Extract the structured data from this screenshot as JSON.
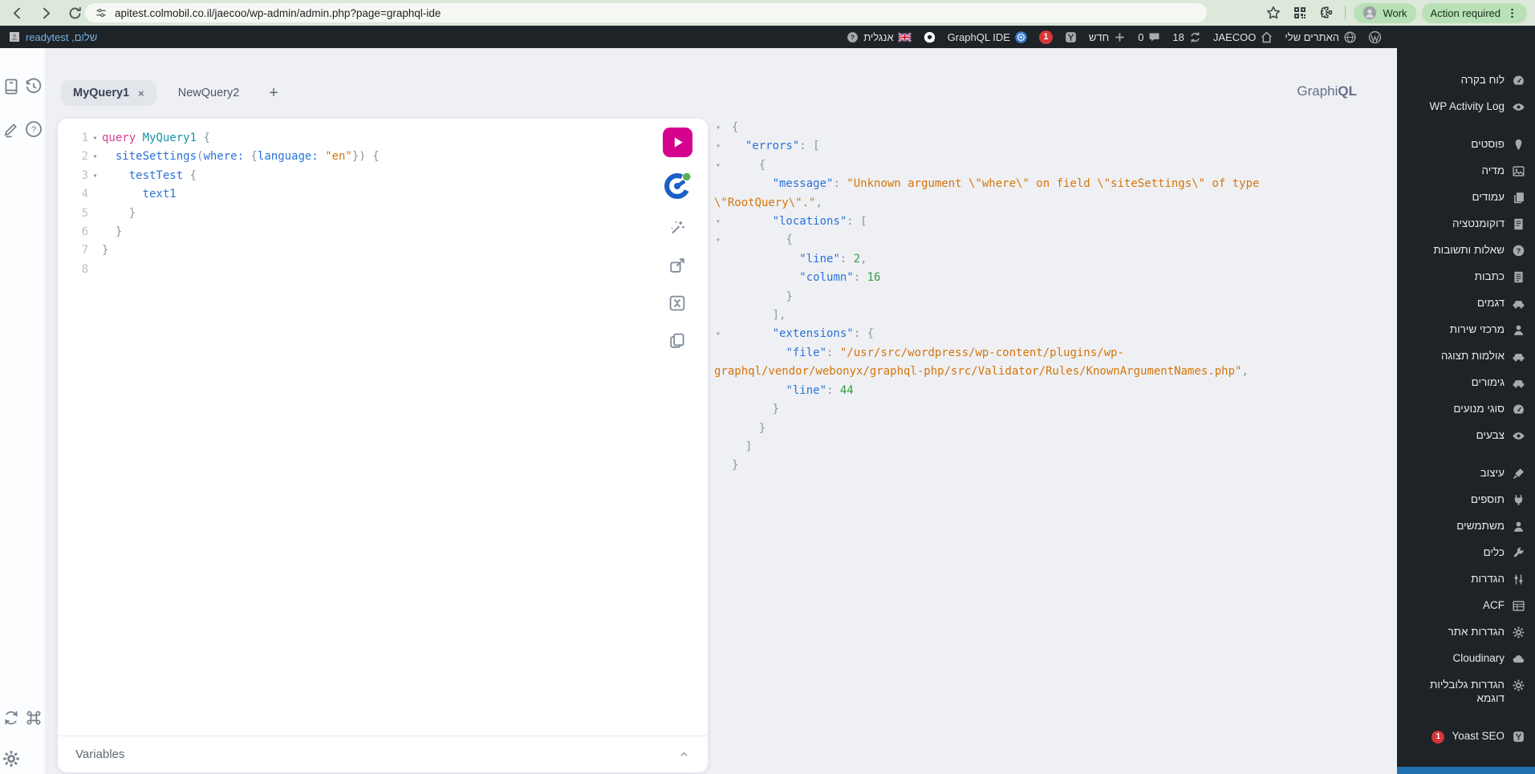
{
  "browser": {
    "url": "apitest.colmobil.co.il/jaecoo/wp-admin/admin.php?page=graphql-ide",
    "profile_label": "Work",
    "action_button": "Action required"
  },
  "admin_bar": {
    "greeting": "שלום, readytest",
    "items": [
      {
        "icon": "wp-logo",
        "name": "wordpress-logo"
      },
      {
        "icon": "network-icon",
        "label": "האתרים שלי",
        "name": "my-sites"
      },
      {
        "icon": "home-icon",
        "label": "JAECOO",
        "name": "site-name"
      },
      {
        "icon": "update-icon",
        "label": "18",
        "name": "updates"
      },
      {
        "icon": "comment-icon",
        "label": "0",
        "name": "comments"
      },
      {
        "icon": "plus-icon",
        "label": "חדש",
        "name": "new-content"
      },
      {
        "icon": "yoast-icon",
        "name": "yoast-seo"
      },
      {
        "badge": "1",
        "name": "notification"
      },
      {
        "icon": "gql-badge",
        "label": "GraphQL IDE",
        "name": "graphql-ide"
      },
      {
        "icon": "qm-icon",
        "name": "query-monitor"
      },
      {
        "icon": "flag-uk",
        "label": "אנגלית",
        "post_icon": "help-circle",
        "name": "language"
      }
    ]
  },
  "sidebar": {
    "accent": "#2271b1",
    "items": [
      {
        "label": "לוח בקרה",
        "icon": "dashboard-icon",
        "name": "dashboard"
      },
      {
        "label": "WP Activity Log",
        "icon": "eye-icon",
        "name": "wp-activity-log"
      },
      {
        "label": "פוסטים",
        "icon": "pin-icon",
        "name": "posts",
        "gap": true
      },
      {
        "label": "מדיה",
        "icon": "media-icon",
        "name": "media"
      },
      {
        "label": "עמודים",
        "icon": "pages-icon",
        "name": "pages"
      },
      {
        "label": "דוקומנטציה",
        "icon": "document-icon",
        "name": "documentation"
      },
      {
        "label": "שאלות ותשובות",
        "icon": "question-icon",
        "name": "faq"
      },
      {
        "label": "כתבות",
        "icon": "article-icon",
        "name": "articles"
      },
      {
        "label": "דגמים",
        "icon": "car-icon",
        "name": "models"
      },
      {
        "label": "מרכזי שירות",
        "icon": "person-icon",
        "name": "service-centers"
      },
      {
        "label": "אולמות תצוגה",
        "icon": "car-icon",
        "name": "showrooms"
      },
      {
        "label": "גימורים",
        "icon": "car-icon",
        "name": "trims"
      },
      {
        "label": "סוגי מנועים",
        "icon": "dashboard-icon",
        "name": "engine-types"
      },
      {
        "label": "צבעים",
        "icon": "eye-icon",
        "name": "colors"
      },
      {
        "label": "עיצוב",
        "icon": "brush-icon",
        "name": "appearance",
        "gap": true
      },
      {
        "label": "תוספים",
        "icon": "plug-icon",
        "name": "plugins"
      },
      {
        "label": "משתמשים",
        "icon": "person-icon",
        "name": "users"
      },
      {
        "label": "כלים",
        "icon": "wrench-icon",
        "name": "tools"
      },
      {
        "label": "הגדרות",
        "icon": "sliders-icon",
        "name": "settings"
      },
      {
        "label": "ACF",
        "icon": "table-icon",
        "name": "acf"
      },
      {
        "label": "הגדרות אתר",
        "icon": "gear-icon",
        "name": "site-settings"
      },
      {
        "label": "Cloudinary",
        "icon": "cloud-icon",
        "name": "cloudinary"
      },
      {
        "label": "הגדרות גלובליות דוגמא",
        "icon": "gear-icon",
        "name": "global-settings-sample"
      },
      {
        "label": "Yoast SEO",
        "icon": "yoast-icon",
        "badge": "1",
        "name": "yoast-seo",
        "gap": true
      }
    ]
  },
  "graphiql": {
    "logo_prefix": "Graphi",
    "logo_suffix": "QL",
    "variables_label": "Variables",
    "add_tab_glyph": "+",
    "fold_glyph": "▾",
    "tabs": [
      {
        "label": "MyQuery1",
        "active": true,
        "close_glyph": "×"
      },
      {
        "label": "NewQuery2",
        "active": false
      }
    ],
    "rail_top": [
      {
        "icon": "book-icon",
        "name": "docs-button"
      },
      {
        "icon": "history-icon",
        "name": "history-button"
      },
      {
        "icon": "pencil-icon",
        "name": "edit-button"
      },
      {
        "icon": "help-outline",
        "name": "help-button"
      }
    ],
    "rail_bottom": [
      {
        "icon": "refresh-icon",
        "name": "refetch-schema-button"
      },
      {
        "icon": "cmd-icon",
        "name": "keyboard-shortcuts-button"
      },
      {
        "icon": "gear-icon",
        "name": "settings-button"
      }
    ],
    "editor_buttons": [
      {
        "icon": "play-icon",
        "name": "execute-query-button",
        "cls": "btn-play"
      },
      {
        "icon": "wpgraphql-icon",
        "name": "auth-toggle-button",
        "cls": "btn-auth"
      },
      {
        "icon": "prettify-icon",
        "name": "prettify-button"
      },
      {
        "icon": "share-icon",
        "name": "share-query-button"
      },
      {
        "icon": "merge-icon",
        "name": "merge-fragments-button"
      },
      {
        "icon": "copy-icon",
        "name": "copy-query-button"
      }
    ],
    "editor_lines": [
      {
        "num": "1",
        "fold": true,
        "tokens": [
          [
            "kw",
            "query"
          ],
          [
            "pl",
            " "
          ],
          [
            "def",
            "MyQuery1"
          ],
          [
            "pun",
            " {"
          ]
        ]
      },
      {
        "num": "2",
        "fold": true,
        "tokens": [
          [
            "pl",
            "  "
          ],
          [
            "fld",
            "siteSettings"
          ],
          [
            "pun",
            "("
          ],
          [
            "fld",
            "where:"
          ],
          [
            "pl",
            " "
          ],
          [
            "pun",
            "{"
          ],
          [
            "fld",
            "language:"
          ],
          [
            "pl",
            " "
          ],
          [
            "str",
            "\"en\""
          ],
          [
            "pun",
            "}) {"
          ]
        ]
      },
      {
        "num": "3",
        "fold": true,
        "tokens": [
          [
            "pl",
            "    "
          ],
          [
            "fld",
            "testTest"
          ],
          [
            "pun",
            " {"
          ]
        ]
      },
      {
        "num": "4",
        "fold": false,
        "tokens": [
          [
            "pl",
            "      "
          ],
          [
            "fld",
            "text1"
          ]
        ]
      },
      {
        "num": "5",
        "fold": false,
        "tokens": [
          [
            "pun",
            "    }"
          ]
        ]
      },
      {
        "num": "6",
        "fold": false,
        "tokens": [
          [
            "pun",
            "  }"
          ]
        ]
      },
      {
        "num": "7",
        "fold": false,
        "tokens": [
          [
            "pun",
            "}"
          ]
        ]
      },
      {
        "num": "8",
        "fold": false,
        "tokens": []
      }
    ],
    "response_lines": [
      {
        "fold": true,
        "tokens": [
          [
            "pun",
            "{"
          ]
        ]
      },
      {
        "fold": true,
        "tokens": [
          [
            "pl",
            "  "
          ],
          [
            "key",
            "\"errors\""
          ],
          [
            "pun",
            ": ["
          ]
        ]
      },
      {
        "fold": true,
        "tokens": [
          [
            "pl",
            "    "
          ],
          [
            "pun",
            "{"
          ]
        ]
      },
      {
        "fold": false,
        "tokens": [
          [
            "pl",
            "      "
          ],
          [
            "key",
            "\"message\""
          ],
          [
            "pun",
            ": "
          ],
          [
            "str",
            "\"Unknown argument \\\"where\\\" on field \\\"siteSettings\\\" of type \\\"RootQuery\\\".\""
          ],
          [
            "pun",
            ","
          ]
        ]
      },
      {
        "fold": true,
        "tokens": [
          [
            "pl",
            "      "
          ],
          [
            "key",
            "\"locations\""
          ],
          [
            "pun",
            ": ["
          ]
        ]
      },
      {
        "fold": true,
        "tokens": [
          [
            "pl",
            "        "
          ],
          [
            "pun",
            "{"
          ]
        ]
      },
      {
        "fold": false,
        "tokens": [
          [
            "pl",
            "          "
          ],
          [
            "key",
            "\"line\""
          ],
          [
            "pun",
            ": "
          ],
          [
            "num",
            "2"
          ],
          [
            "pun",
            ","
          ]
        ]
      },
      {
        "fold": false,
        "tokens": [
          [
            "pl",
            "          "
          ],
          [
            "key",
            "\"column\""
          ],
          [
            "pun",
            ": "
          ],
          [
            "num",
            "16"
          ]
        ]
      },
      {
        "fold": false,
        "tokens": [
          [
            "pl",
            "        "
          ],
          [
            "pun",
            "}"
          ]
        ]
      },
      {
        "fold": false,
        "tokens": [
          [
            "pl",
            "      "
          ],
          [
            "pun",
            "],"
          ]
        ]
      },
      {
        "fold": true,
        "tokens": [
          [
            "pl",
            "      "
          ],
          [
            "key",
            "\"extensions\""
          ],
          [
            "pun",
            ": {"
          ]
        ]
      },
      {
        "fold": false,
        "tokens": [
          [
            "pl",
            "        "
          ],
          [
            "key",
            "\"file\""
          ],
          [
            "pun",
            ": "
          ],
          [
            "str",
            "\"/usr/src/wordpress/wp-content/plugins/wp-graphql/vendor/webonyx/graphql-php/src/Validator/Rules/KnownArgumentNames.php\""
          ],
          [
            "pun",
            ","
          ]
        ]
      },
      {
        "fold": false,
        "tokens": [
          [
            "pl",
            "        "
          ],
          [
            "key",
            "\"line\""
          ],
          [
            "pun",
            ": "
          ],
          [
            "num",
            "44"
          ]
        ]
      },
      {
        "fold": false,
        "tokens": [
          [
            "pl",
            "      "
          ],
          [
            "pun",
            "}"
          ]
        ]
      },
      {
        "fold": false,
        "tokens": [
          [
            "pl",
            "    "
          ],
          [
            "pun",
            "}"
          ]
        ]
      },
      {
        "fold": false,
        "tokens": [
          [
            "pl",
            "  "
          ],
          [
            "pun",
            "]"
          ]
        ]
      },
      {
        "fold": false,
        "tokens": [
          [
            "pun",
            "}"
          ]
        ]
      }
    ]
  }
}
